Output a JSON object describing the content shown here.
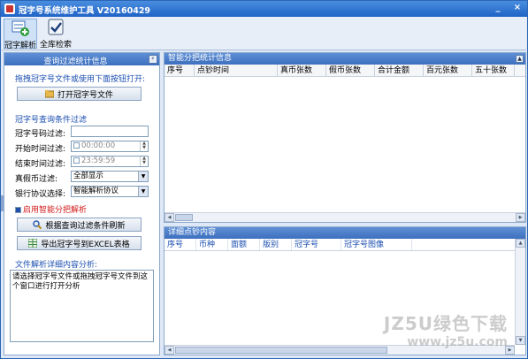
{
  "window": {
    "title": "冠字号系统维护工具 V20160429",
    "min": "_",
    "close": "×"
  },
  "toolbar": {
    "items": [
      {
        "label": "冠字解析",
        "icon": "add-document-icon",
        "active": true
      },
      {
        "label": "全库检索",
        "icon": "check-icon",
        "active": false
      }
    ]
  },
  "left_panel": {
    "title": "查询过滤统计信息",
    "pin": "ᵖ",
    "drag_hint": "拖拽冠字号文件或使用下面按钮打开:",
    "open_button": "打开冠字号文件",
    "filter_section": "冠字号查询条件过滤",
    "serial_label": "冠字号码过滤:",
    "serial_value": "",
    "start_label": "开始时间过滤:",
    "start_value": "00:00:00",
    "end_label": "结束时间过滤:",
    "end_value": "23:59:59",
    "authenticity_label": "真假币过滤:",
    "authenticity_value": "全部显示",
    "protocol_label": "银行协议选择:",
    "protocol_value": "智能解析协议",
    "smart_label": "启用智能分把解析",
    "refresh_button": "根据查询过滤条件刷新",
    "export_button": "导出冠字号到EXCEL表格",
    "analysis_label": "文件解析详细内容分析:",
    "analysis_text": "请选择冠字号文件或拖拽冠字号文件到这个窗口进行打开分析"
  },
  "stats_panel": {
    "title": "智能分把统计信息",
    "columns": [
      "序号",
      "点钞时间",
      "真币张数",
      "假币张数",
      "合计金额",
      "百元张数",
      "五十张数"
    ]
  },
  "detail_panel": {
    "title": "详细点钞内容",
    "columns": [
      "序号",
      "币种",
      "面额",
      "版别",
      "冠字号",
      "冠字号图像"
    ]
  },
  "watermark": {
    "line1": "JZ5U绿色下载",
    "line2": "www.jz5u.com"
  },
  "colors": {
    "title_bar": "#1f63c6",
    "panel_header": "#3c6fbe",
    "accent_blue": "#1c4fb0",
    "accent_red": "#d21a1a"
  }
}
